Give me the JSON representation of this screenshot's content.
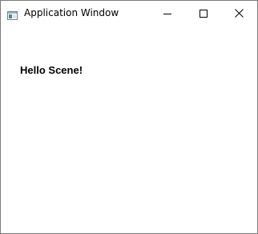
{
  "window": {
    "title": "Application Window",
    "icon": "application-window-icon",
    "controls": {
      "minimize_icon": "minimize-icon",
      "maximize_icon": "maximize-icon",
      "close_icon": "close-icon"
    }
  },
  "scene": {
    "label": "Hello Scene!"
  },
  "colors": {
    "background": "#ffffff",
    "border": "#7a7a7a",
    "text": "#000000"
  }
}
